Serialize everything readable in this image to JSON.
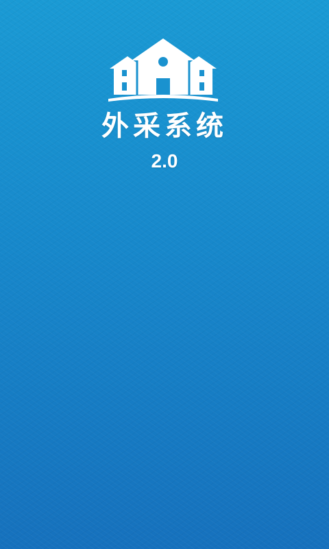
{
  "splash": {
    "title": "外采系统",
    "version": "2.0",
    "logo_icon": "houses-logo-icon",
    "background_color_top": "#1a9ad4",
    "background_color_bottom": "#1671bd",
    "text_color": "#ffffff"
  }
}
